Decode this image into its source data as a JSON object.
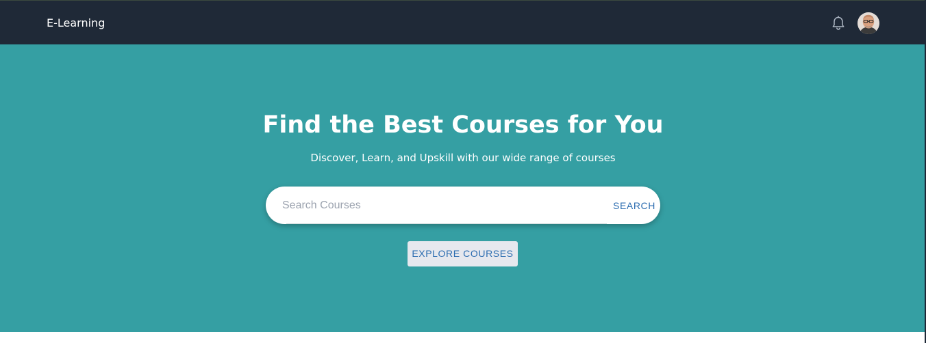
{
  "navbar": {
    "brand": "E-Learning",
    "bell_icon": "bell-icon",
    "avatar_icon": "user-avatar"
  },
  "hero": {
    "title": "Find the Best Courses for You",
    "subtitle": "Discover, Learn, and Upskill with our wide range of courses",
    "search": {
      "placeholder": "Search Courses",
      "value": "",
      "button_label": "SEARCH"
    },
    "explore_label": "EXPLORE COURSES"
  },
  "colors": {
    "navbar_bg": "#1f2937",
    "hero_bg": "#359fa3",
    "accent_text": "#2b6cb0",
    "explore_bg": "#e6e8ee",
    "white": "#ffffff"
  }
}
